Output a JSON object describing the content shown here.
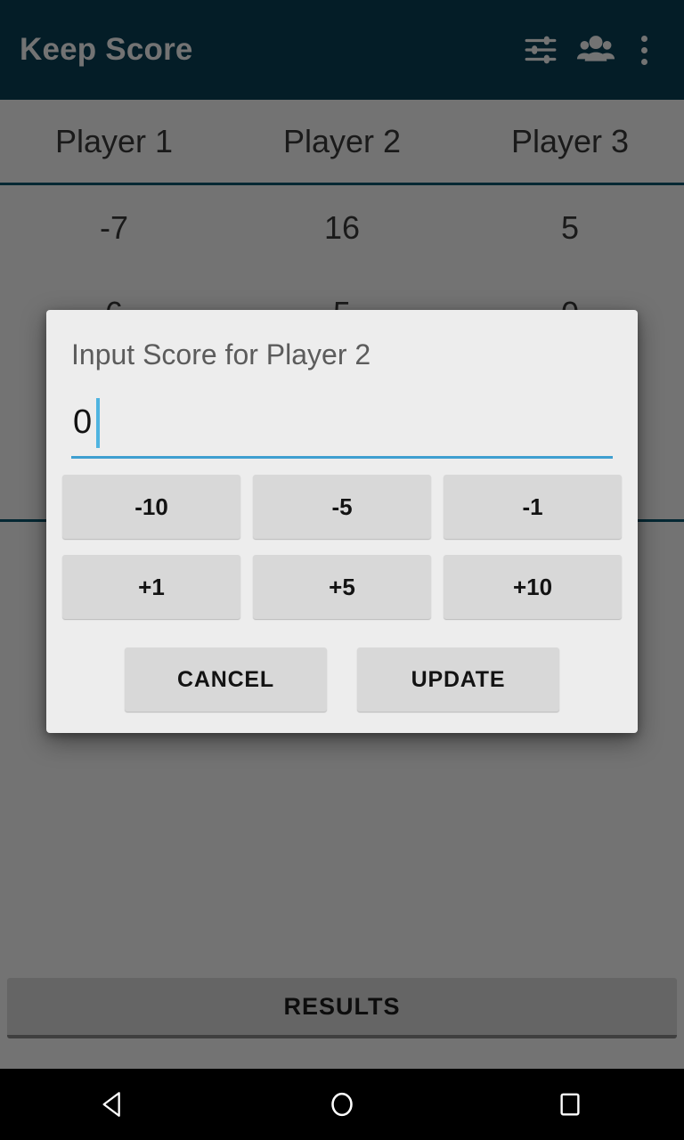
{
  "appbar": {
    "title": "Keep Score",
    "actions": [
      {
        "name": "tune-icon",
        "label": "Settings"
      },
      {
        "name": "people-group-icon",
        "label": "Players"
      },
      {
        "name": "overflow-menu-icon",
        "label": "More options"
      }
    ]
  },
  "scoreboard": {
    "columns": [
      "Player 1",
      "Player 2",
      "Player 3"
    ],
    "rows": [
      [
        "-7",
        "16",
        "5"
      ],
      [
        "6",
        "5",
        "0"
      ]
    ]
  },
  "results": {
    "label": "RESULTS"
  },
  "dialog": {
    "title": "Input Score for Player 2",
    "input": {
      "value": "0",
      "placeholder": "0"
    },
    "adjust_buttons_row1": [
      "-10",
      "-5",
      "-1"
    ],
    "adjust_buttons_row2": [
      "+1",
      "+5",
      "+10"
    ],
    "cancel_label": "CANCEL",
    "update_label": "UPDATE"
  },
  "navbar": {
    "back": "back-icon",
    "home": "home-icon",
    "recents": "recents-icon"
  },
  "colors": {
    "appbar": "#0a4158",
    "divider": "#0d5a72",
    "accent": "#3f9fd0",
    "caret": "#4fb4e0",
    "dialog_bg": "#ededed",
    "button_bg": "#d8d8d8"
  }
}
